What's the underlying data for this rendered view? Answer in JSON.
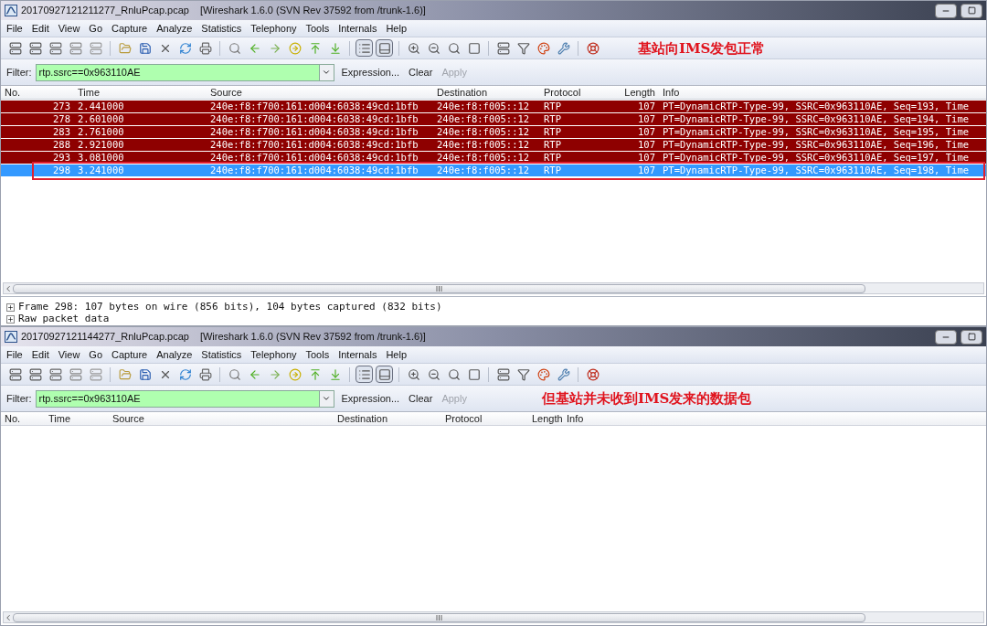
{
  "windows": [
    {
      "title": "20170927121211277_RnluPcap.pcap",
      "app_title": "[Wireshark 1.6.0  (SVN Rev 37592 from /trunk-1.6)]",
      "menu": [
        "File",
        "Edit",
        "View",
        "Go",
        "Capture",
        "Analyze",
        "Statistics",
        "Telephony",
        "Tools",
        "Internals",
        "Help"
      ],
      "filter": {
        "label": "Filter:",
        "value": "rtp.ssrc==0x963110AE",
        "actions": [
          {
            "label": "Expression...",
            "disabled": false
          },
          {
            "label": "Clear",
            "disabled": false
          },
          {
            "label": "Apply",
            "disabled": true
          }
        ]
      },
      "toolbar_annotation": "基站向IMS发包正常",
      "columns": [
        "No.",
        "Time",
        "Source",
        "Destination",
        "Protocol",
        "Length",
        "Info"
      ],
      "rows": [
        {
          "no": "273",
          "time": "2.441000",
          "source": "240e:f8:f700:161:d004:6038:49cd:1bfb",
          "destination": "240e:f8:f005::12",
          "protocol": "RTP",
          "length": "107",
          "info": "PT=DynamicRTP-Type-99, SSRC=0x963110AE, Seq=193, Time",
          "selected": false,
          "outlined": false
        },
        {
          "no": "278",
          "time": "2.601000",
          "source": "240e:f8:f700:161:d004:6038:49cd:1bfb",
          "destination": "240e:f8:f005::12",
          "protocol": "RTP",
          "length": "107",
          "info": "PT=DynamicRTP-Type-99, SSRC=0x963110AE, Seq=194, Time",
          "selected": false,
          "outlined": false
        },
        {
          "no": "283",
          "time": "2.761000",
          "source": "240e:f8:f700:161:d004:6038:49cd:1bfb",
          "destination": "240e:f8:f005::12",
          "protocol": "RTP",
          "length": "107",
          "info": "PT=DynamicRTP-Type-99, SSRC=0x963110AE, Seq=195, Time",
          "selected": false,
          "outlined": false
        },
        {
          "no": "288",
          "time": "2.921000",
          "source": "240e:f8:f700:161:d004:6038:49cd:1bfb",
          "destination": "240e:f8:f005::12",
          "protocol": "RTP",
          "length": "107",
          "info": "PT=DynamicRTP-Type-99, SSRC=0x963110AE, Seq=196, Time",
          "selected": false,
          "outlined": false
        },
        {
          "no": "293",
          "time": "3.081000",
          "source": "240e:f8:f700:161:d004:6038:49cd:1bfb",
          "destination": "240e:f8:f005::12",
          "protocol": "RTP",
          "length": "107",
          "info": "PT=DynamicRTP-Type-99, SSRC=0x963110AE, Seq=197, Time",
          "selected": false,
          "outlined": false
        },
        {
          "no": "298",
          "time": "3.241000",
          "source": "240e:f8:f700:161:d004:6038:49cd:1bfb",
          "destination": "240e:f8:f005::12",
          "protocol": "RTP",
          "length": "107",
          "info": "PT=DynamicRTP-Type-99, SSRC=0x963110AE, Seq=198, Time",
          "selected": true,
          "outlined": true
        }
      ],
      "details": [
        {
          "text": "Frame 298: 107 bytes on wire (856 bits), 104 bytes captured (832 bits)",
          "expanded": false
        },
        {
          "text": "Raw packet data",
          "expanded": false
        }
      ]
    },
    {
      "title": "20170927121144277_RnluPcap.pcap",
      "app_title": "[Wireshark 1.6.0  (SVN Rev 37592 from /trunk-1.6)]",
      "menu": [
        "File",
        "Edit",
        "View",
        "Go",
        "Capture",
        "Analyze",
        "Statistics",
        "Telephony",
        "Tools",
        "Internals",
        "Help"
      ],
      "filter": {
        "label": "Filter:",
        "value": "rtp.ssrc==0x963110AE",
        "actions": [
          {
            "label": "Expression...",
            "disabled": false
          },
          {
            "label": "Clear",
            "disabled": false
          },
          {
            "label": "Apply",
            "disabled": true
          }
        ],
        "annotation": "但基站并未收到IMS发来的数据包"
      },
      "columns": [
        "No.",
        "Time",
        "Source",
        "Destination",
        "Protocol",
        "Length",
        "Info"
      ]
    }
  ]
}
